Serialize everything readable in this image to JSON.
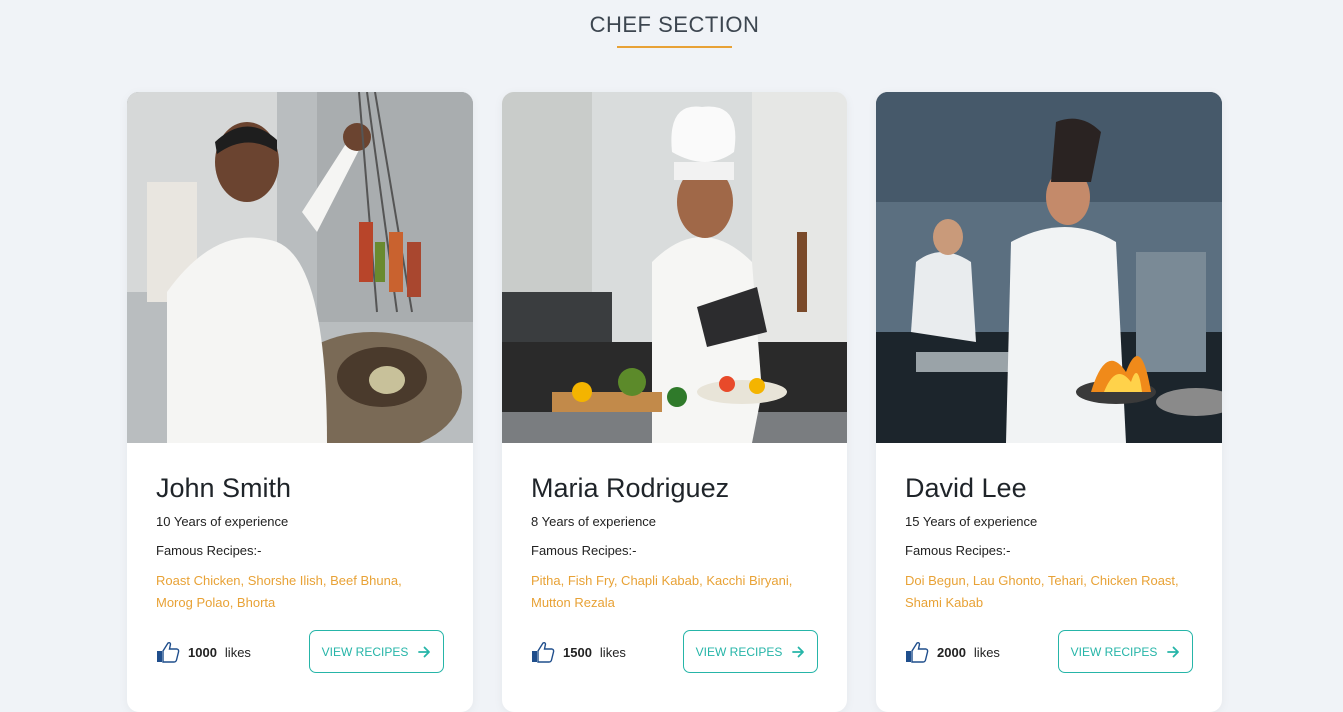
{
  "section": {
    "title": "CHEF SECTION"
  },
  "colors": {
    "accent": "#e8a236",
    "button": "#26b5a8",
    "background": "#f0f3f7"
  },
  "chefs": [
    {
      "name": "John Smith",
      "experience": "10 Years of experience",
      "famous_label": "Famous Recipes:-",
      "recipes": "Roast Chicken, Shorshe Ilish, Beef Bhuna, Morog Polao, Bhorta",
      "likes_count": "1000",
      "likes_label": "likes",
      "button_label": "VIEW RECIPES",
      "photo_icon": "chef-photo"
    },
    {
      "name": "Maria Rodriguez",
      "experience": "8 Years of experience",
      "famous_label": "Famous Recipes:-",
      "recipes": "Pitha, Fish Fry, Chapli Kabab, Kacchi Biryani, Mutton Rezala",
      "likes_count": "1500",
      "likes_label": "likes",
      "button_label": "VIEW RECIPES",
      "photo_icon": "chef-photo"
    },
    {
      "name": "David Lee",
      "experience": "15 Years of experience",
      "famous_label": "Famous Recipes:-",
      "recipes": "Doi Begun, Lau Ghonto, Tehari, Chicken Roast, Shami Kabab",
      "likes_count": "2000",
      "likes_label": "likes",
      "button_label": "VIEW RECIPES",
      "photo_icon": "chef-photo"
    }
  ]
}
